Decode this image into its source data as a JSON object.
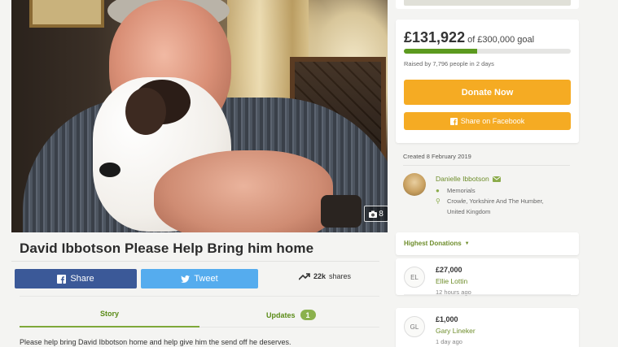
{
  "photo": {
    "count": "8"
  },
  "campaign": {
    "title": "David Ibbotson Please Help Bring him home"
  },
  "share": {
    "facebook_label": "Share",
    "twitter_label": "Tweet",
    "count": "22k",
    "count_suffix": "shares"
  },
  "tabs": [
    {
      "label": "Story"
    },
    {
      "label": "Updates",
      "count": "1"
    }
  ],
  "story": {
    "text": "Please help bring David Ibbotson home and help give him the send off he deserves."
  },
  "goal": {
    "raised": "£131,922",
    "goal_text": "of £300,000 goal",
    "progress_fraction": 0.44,
    "raised_by": "Raised by 7,796 people in 2 days",
    "donate_label": "Donate Now",
    "share_facebook_label": "Share on Facebook"
  },
  "created": "Created 8 February 2019",
  "organizer": {
    "name": "Danielle Ibbotson",
    "category": "Memorials",
    "location_line1": "Crowle, Yorkshire And The Humber,",
    "location_line2": "United Kingdom"
  },
  "highest_donations": {
    "title": "Highest Donations",
    "items": [
      {
        "initials": "EL",
        "amount": "£27,000",
        "name": "Ellie Lottin",
        "time": "12 hours ago"
      },
      {
        "initials": "GL",
        "amount": "£1,000",
        "name": "Gary Lineker",
        "time": "1 day ago"
      }
    ]
  },
  "colors": {
    "facebook": "#3b5998",
    "twitter": "#55acee",
    "donate": "#f5ab23",
    "progress": "#5c9a1f",
    "accent_green": "#6e8d2b"
  }
}
